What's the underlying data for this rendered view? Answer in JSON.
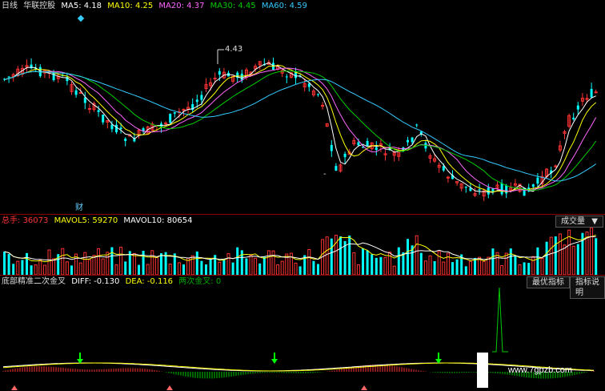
{
  "price_panel": {
    "period": "日线",
    "stock_name": "华联控股",
    "ma": [
      {
        "label": "MA5:",
        "value": "4.18",
        "color": "#ffffff"
      },
      {
        "label": "MA10:",
        "value": "4.25",
        "color": "#ffff00"
      },
      {
        "label": "MA20:",
        "value": "4.37",
        "color": "#ff66ff"
      },
      {
        "label": "MA30:",
        "value": "4.45",
        "color": "#00cc00"
      },
      {
        "label": "MA60:",
        "value": "4.59",
        "color": "#33ccff"
      }
    ],
    "high_label": "4.43",
    "low_label": "-",
    "finance_marker": "财"
  },
  "volume_panel": {
    "label": "总手:",
    "value": "36073",
    "mavol5_label": "MAVOL5:",
    "mavol5": "59270",
    "mavol10_label": "MAVOL10:",
    "mavol10": "80654",
    "selector": "成交量"
  },
  "indicator_panel": {
    "name": "底部精准二次金叉",
    "diff_label": "DIFF:",
    "diff": "-0.130",
    "dea_label": "DEA:",
    "dea": "-0.116",
    "cross_label": "两次金叉:",
    "cross": "0",
    "btn_best": "最优指标",
    "btn_help": "指标说明"
  },
  "watermark": "www.7gpzb.com",
  "colors": {
    "up": "#ff3333",
    "down": "#00ffff",
    "ma5": "#ffffff",
    "ma10": "#ffff00",
    "ma20": "#ff66ff",
    "ma30": "#00cc00",
    "ma60": "#33ccff"
  }
}
